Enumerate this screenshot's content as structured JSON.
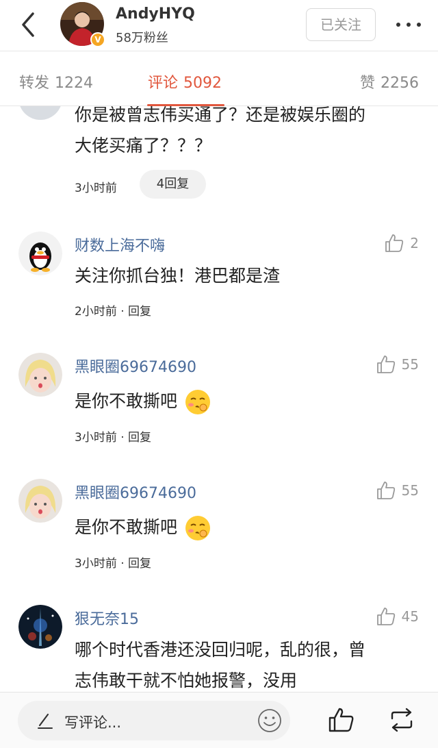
{
  "header": {
    "username": "AndyHYQ",
    "fans": "58万粉丝",
    "verified_badge": "V",
    "follow_label": "已关注"
  },
  "tabs": {
    "repost_label": "转发",
    "repost_count": "1224",
    "comment_label": "评论",
    "comment_count": "5092",
    "like_label": "赞",
    "like_count": "2256",
    "active": "comment"
  },
  "comments": [
    {
      "name": "",
      "text_lines": [
        "你是被曾志伟买通了？还是被娱乐圈的",
        "大佬买痛了？？？"
      ],
      "time": "3小时前",
      "replies": "4回复"
    },
    {
      "name": "财数上海不嗨",
      "text": "关注你抓台独！港巴都是渣",
      "time": "2小时前",
      "reply": "· 回复",
      "likes": "2",
      "avatar_icon": "qq-penguin-icon"
    },
    {
      "name": "黑眼圈69674690",
      "text": "是你不敢撕吧",
      "time": "3小时前",
      "reply": "· 回复",
      "likes": "55",
      "avatar_icon": "cartoon-girl-icon",
      "emoji": "smirk-emoji-icon"
    },
    {
      "name": "黑眼圈69674690",
      "text": "是你不敢撕吧",
      "time": "3小时前",
      "reply": "· 回复",
      "likes": "55",
      "avatar_icon": "cartoon-girl-icon",
      "emoji": "smirk-emoji-icon"
    },
    {
      "name": "狠无奈15",
      "text_lines": [
        "哪个时代香港还没回归呢，乱的很，曾",
        "志伟敢干就不怕她报警，没用"
      ],
      "likes": "45",
      "avatar_icon": "galaxy-icon"
    }
  ],
  "bottom": {
    "input_placeholder": "写评论..."
  },
  "colors": {
    "accent": "#e1573d",
    "name_blue": "#4a6b9a",
    "muted": "#999999",
    "badge": "#f5a623"
  }
}
